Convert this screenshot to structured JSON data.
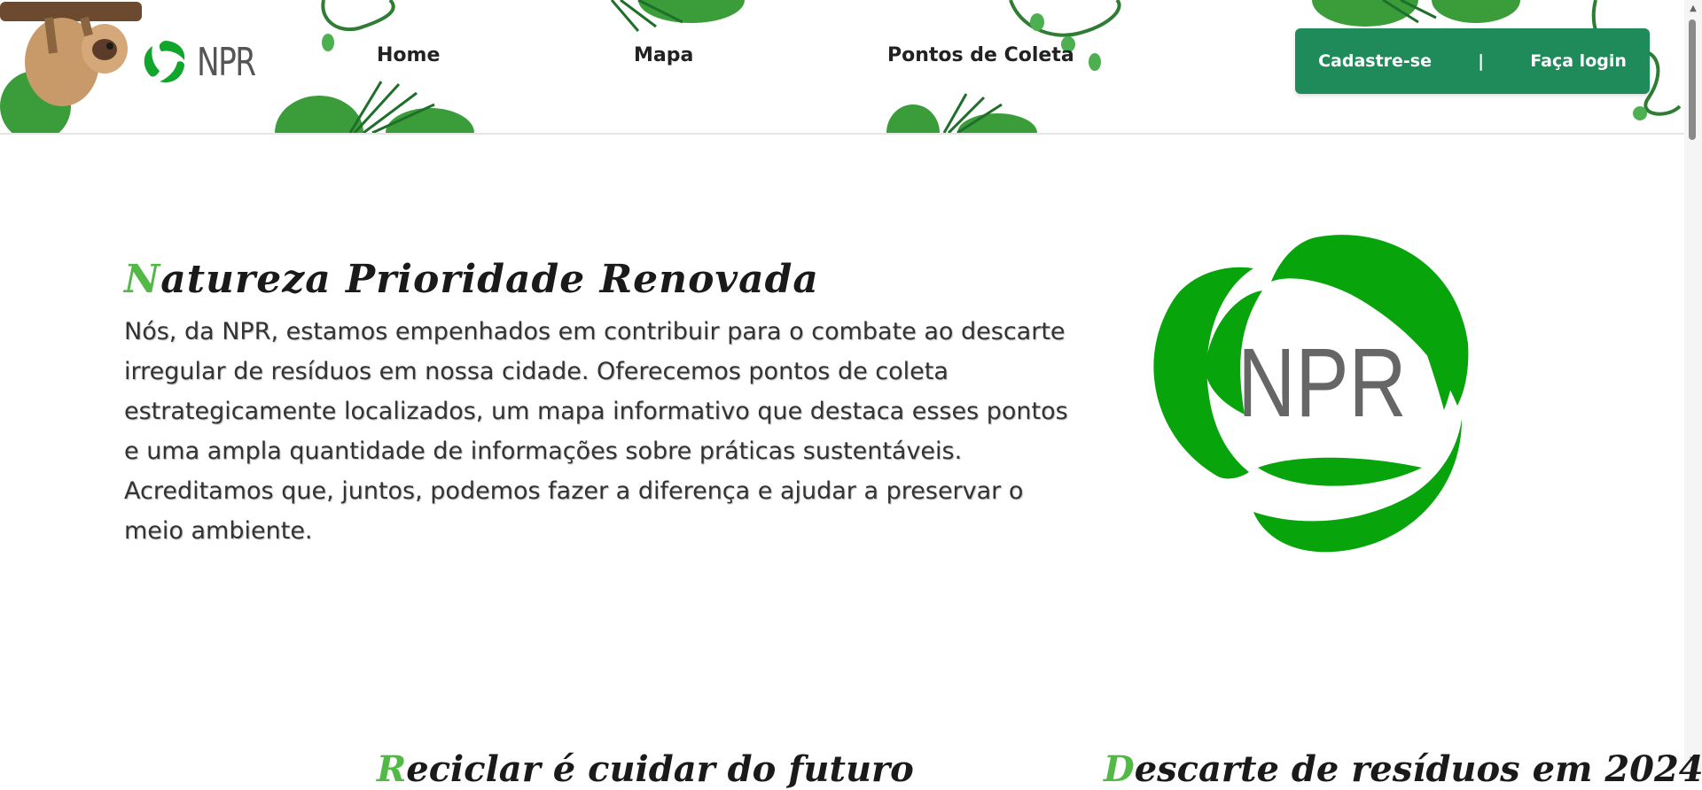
{
  "brand": {
    "logo_text": "NPR",
    "accent_color": "#52b947",
    "primary_color": "#1f8a5a"
  },
  "nav": {
    "items": [
      {
        "label": "Home"
      },
      {
        "label": "Mapa"
      },
      {
        "label": "Pontos de Coleta"
      }
    ]
  },
  "auth": {
    "signup_label": "Cadastre-se",
    "separator": "|",
    "login_label": "Faça login"
  },
  "hero": {
    "title_first": "N",
    "title_rest": "atureza Prioridade Renovada",
    "text": "Nós, da NPR, estamos empenhados em contribuir para o combate ao descarte irregular de resíduos em nossa cidade. Oferecemos pontos de coleta estrategicamente localizados, um mapa informativo que destaca esses pontos e uma ampla quantidade de informações sobre práticas sustentáveis. Acreditamos que, juntos, podemos fazer a diferença e ajudar a preservar o meio ambiente.",
    "logo_text": "NPR"
  },
  "sections": [
    {
      "first": "R",
      "rest": "eciclar é cuidar do futuro"
    },
    {
      "first": "D",
      "rest": "escarte de resíduos em 2024"
    }
  ],
  "icons": {
    "mascot": "sloth-icon",
    "recycle": "recycle-leaves-icon"
  }
}
